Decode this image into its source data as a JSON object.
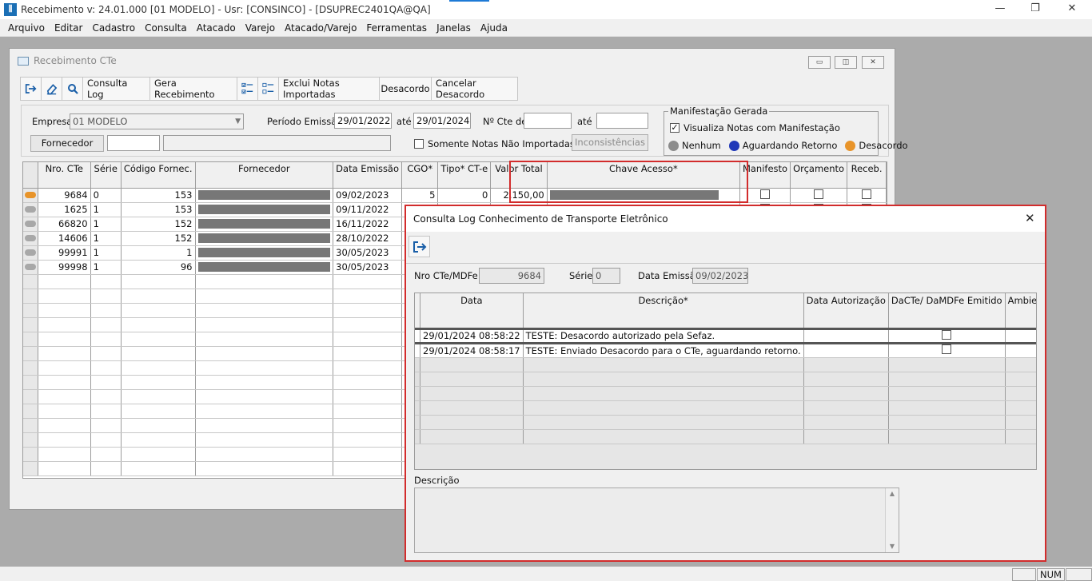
{
  "window": {
    "title": "Recebimento  v: 24.01.000  [01 MODELO] - Usr: [CONSINCO] - [DSUPREC2401QA@QA]",
    "icon": "app-logo-icon"
  },
  "menu": [
    "Arquivo",
    "Editar",
    "Cadastro",
    "Consulta",
    "Atacado",
    "Varejo",
    "Atacado/Varejo",
    "Ferramentas",
    "Janelas",
    "Ajuda"
  ],
  "child": {
    "title": "Recebimento CTe",
    "toolbar": {
      "consulta_log": "Consulta Log",
      "gera_recebimento": "Gera Recebimento",
      "exclui": "Exclui Notas Importadas",
      "desacordo": "Desacordo",
      "cancelar_desacordo": "Cancelar Desacordo"
    },
    "filters": {
      "empresa_label": "Empresa",
      "empresa_value": "01 MODELO",
      "periodo_label": "Período Emissão",
      "periodo_de": "29/01/2022",
      "ate1": "até",
      "periodo_ate": "29/01/2024",
      "nr_cte_label": "Nº Cte de",
      "nr_cte_de": "",
      "ate2": "até",
      "nr_cte_ate": "",
      "fornecedor_btn": "Fornecedor",
      "fornecedor_code": "",
      "fornecedor_name": "",
      "somente_label": "Somente Notas Não Importadas",
      "inconsistencias": "Inconsistências",
      "manifest_group": "Manifestação Gerada",
      "visualiza_label": "Visualiza Notas com Manifestação",
      "legend": [
        {
          "label": "Nenhum",
          "color": "#8c8c8c"
        },
        {
          "label": "Aguardando Retorno",
          "color": "#2038b8"
        },
        {
          "label": "Desacordo",
          "color": "#e8942a"
        }
      ]
    },
    "grid": {
      "headers": [
        "Nro. CTe",
        "Série",
        "Código Fornec.",
        "Fornecedor",
        "Data Emissão",
        "CGO*",
        "Tipo* CT-e",
        "Valor Total",
        "Chave Acesso*",
        "Manifesto",
        "Orçamento",
        "Receb."
      ],
      "rows": [
        {
          "status": "#e8942a",
          "nro": "9684",
          "serie": "0",
          "cod": "153",
          "data": "09/02/2023",
          "cgo": "5",
          "tipo": "0",
          "valor": "2.150,00"
        },
        {
          "status": "#a8a8a8",
          "nro": "1625",
          "serie": "1",
          "cod": "153",
          "data": "09/11/2022",
          "cgo": "",
          "tipo": "",
          "valor": ""
        },
        {
          "status": "#a8a8a8",
          "nro": "66820",
          "serie": "1",
          "cod": "152",
          "data": "16/11/2022",
          "cgo": "",
          "tipo": "",
          "valor": ""
        },
        {
          "status": "#a8a8a8",
          "nro": "14606",
          "serie": "1",
          "cod": "152",
          "data": "28/10/2022",
          "cgo": "",
          "tipo": "",
          "valor": ""
        },
        {
          "status": "#a8a8a8",
          "nro": "99991",
          "serie": "1",
          "cod": "1",
          "data": "30/05/2023",
          "cgo": "",
          "tipo": "",
          "valor": ""
        },
        {
          "status": "#a8a8a8",
          "nro": "99998",
          "serie": "1",
          "cod": "96",
          "data": "30/05/2023",
          "cgo": "",
          "tipo": "",
          "valor": ""
        }
      ]
    }
  },
  "dialog": {
    "title": "Consulta Log Conhecimento de Transporte Eletrônico",
    "nro_label": "Nro CTe/MDFe",
    "nro_value": "9684",
    "serie_label": "Série",
    "serie_value": "0",
    "data_label": "Data Emissão",
    "data_value": "09/02/2023",
    "headers": [
      "Data",
      "Descrição*",
      "Data Autorização",
      "DaCTe/ DaMDFe Emitido",
      "Ambiente"
    ],
    "rows": [
      {
        "data": "29/01/2024 08:58:22",
        "descricao": "TESTE: Desacordo autorizado pela Sefaz."
      },
      {
        "data": "29/01/2024 08:58:17",
        "descricao": "TESTE: Enviado Desacordo para o CTe, aguardando retorno."
      }
    ],
    "desc_label": "Descrição",
    "desc_value": ""
  },
  "status": {
    "num": "NUM"
  },
  "highlight_color": "#d22c2c"
}
